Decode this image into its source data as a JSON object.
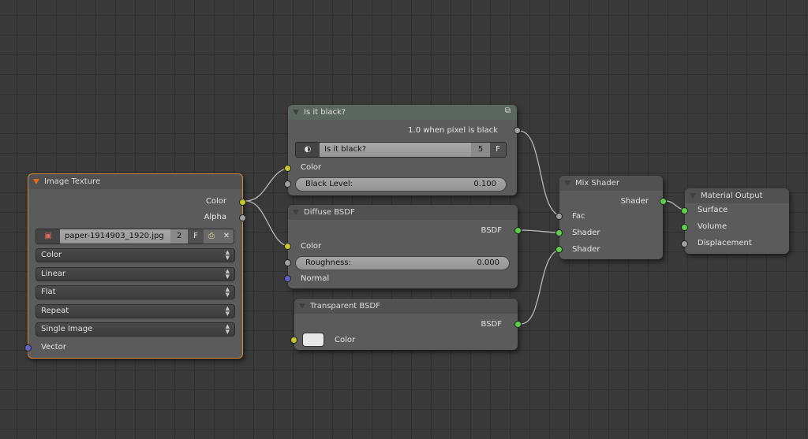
{
  "colors": {
    "background": "#393939",
    "node_body": "#5b5b5b",
    "selected_outline": "#d08a3e",
    "socket_color": "#c7c729",
    "socket_shader": "#5fcf4a",
    "socket_float": "#a1a1a1",
    "socket_vector": "#6363c7"
  },
  "image_texture": {
    "title": "Image Texture",
    "out_color": "Color",
    "out_alpha": "Alpha",
    "image_name": "paper-1914903_1920.jpg",
    "users": "2",
    "fake": "F",
    "color_space": "Color",
    "interpolation": "Linear",
    "projection": "Flat",
    "extension": "Repeat",
    "source": "Single Image",
    "in_vector": "Vector",
    "icons": [
      "image-icon",
      "pack-icon",
      "close-icon"
    ]
  },
  "is_black": {
    "title": "Is it black?",
    "output": "1.0 when pixel is black",
    "group_name": "Is it black?",
    "users": "5",
    "fake": "F",
    "in_color": "Color",
    "black_level_label": "Black Level:",
    "black_level": "0.100",
    "icons": [
      "node-group-icon",
      "sphere-icon"
    ]
  },
  "diffuse": {
    "title": "Diffuse BSDF",
    "output": "BSDF",
    "in_color": "Color",
    "roughness_label": "Roughness:",
    "roughness": "0.000",
    "in_normal": "Normal"
  },
  "transparent": {
    "title": "Transparent BSDF",
    "output": "BSDF",
    "in_color": "Color",
    "color_value": "#e8e8e8"
  },
  "mix": {
    "title": "Mix Shader",
    "output": "Shader",
    "in_fac": "Fac",
    "in_shader1": "Shader",
    "in_shader2": "Shader"
  },
  "output": {
    "title": "Material Output",
    "in_surface": "Surface",
    "in_volume": "Volume",
    "in_displacement": "Displacement"
  }
}
